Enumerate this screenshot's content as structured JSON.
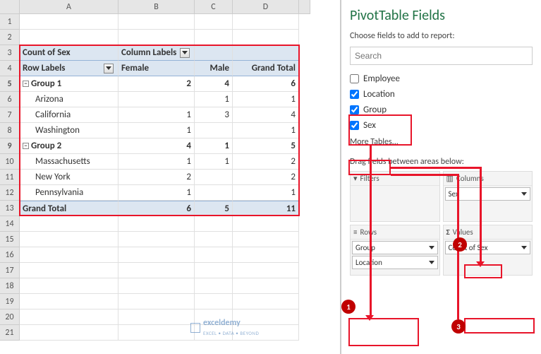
{
  "columns": [
    "A",
    "B",
    "C",
    "D"
  ],
  "sheet": {
    "r3": {
      "A": "Count of Sex",
      "B": "Column Labels"
    },
    "r4": {
      "A": "Row Labels",
      "B": "Female",
      "C": "Male",
      "D": "Grand Total"
    },
    "r5": {
      "A": "Group 1",
      "B": "2",
      "C": "4",
      "D": "6"
    },
    "r6": {
      "A": "Arizona",
      "B": "",
      "C": "1",
      "D": "1"
    },
    "r7": {
      "A": "California",
      "B": "1",
      "C": "3",
      "D": "4"
    },
    "r8": {
      "A": "Washington",
      "B": "1",
      "C": "",
      "D": "1"
    },
    "r9": {
      "A": "Group 2",
      "B": "4",
      "C": "1",
      "D": "5"
    },
    "r10": {
      "A": "Massachusetts",
      "B": "1",
      "C": "1",
      "D": "2"
    },
    "r11": {
      "A": "New York",
      "B": "2",
      "C": "",
      "D": "2"
    },
    "r12": {
      "A": "Pennsylvania",
      "B": "1",
      "C": "",
      "D": "1"
    },
    "r13": {
      "A": "Grand Total",
      "B": "6",
      "C": "5",
      "D": "11"
    }
  },
  "pane": {
    "title": "PivotTable Fields",
    "subtitle": "Choose fields to add to report:",
    "search_placeholder": "Search",
    "fields": [
      {
        "label": "Employee",
        "checked": false
      },
      {
        "label": "Location",
        "checked": true
      },
      {
        "label": "Group",
        "checked": true
      },
      {
        "label": "Sex",
        "checked": true
      }
    ],
    "more_tables": "More Tables...",
    "drag_label": "Drag fields between areas below:",
    "areas": {
      "filters": {
        "label": "Filters",
        "items": []
      },
      "columns": {
        "label": "Columns",
        "items": [
          "Sex"
        ]
      },
      "rows": {
        "label": "Rows",
        "items": [
          "Group",
          "Location"
        ]
      },
      "values": {
        "label": "Values",
        "items": [
          "Count of Sex"
        ]
      }
    }
  },
  "badges": {
    "1": "1",
    "2": "2",
    "3": "3"
  },
  "watermark": {
    "brand": "exceldemy",
    "tag": "EXCEL • DATA • BEYOND"
  }
}
